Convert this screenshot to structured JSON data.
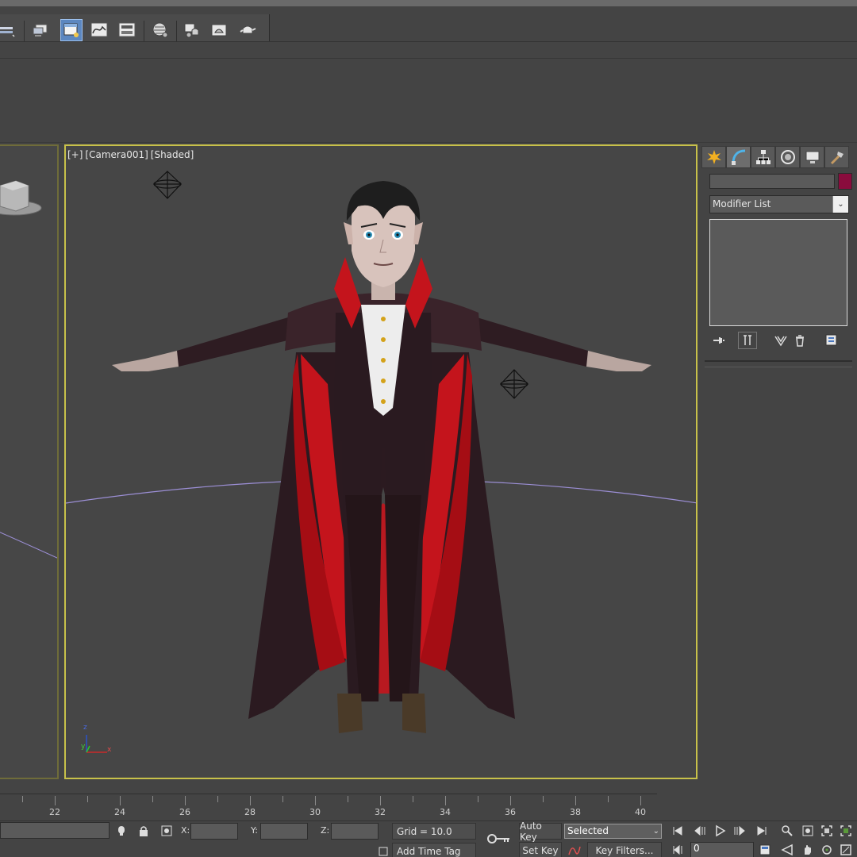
{
  "toolbar": {
    "buttons": [
      "layer-manager-icon",
      "scene-explorer-icon",
      "toggle-ribbon-icon",
      "curve-editor-icon",
      "schematic-view-icon",
      "material-editor-icon",
      "render-setup-icon",
      "rendered-frame-icon",
      "render-icon"
    ]
  },
  "left_viewport": {
    "label": ""
  },
  "main_viewport": {
    "label_plus": "[+]",
    "label_camera": "[Camera001]",
    "label_mode": "[Shaded]",
    "axis_z": "z",
    "axis_y": "y",
    "axis_x": "x"
  },
  "command_panel": {
    "tabs": [
      "create-icon",
      "modify-icon",
      "hierarchy-icon",
      "motion-icon",
      "display-icon",
      "utilities-icon"
    ],
    "object_name": "",
    "object_color": "#8a0c3d",
    "modifier_list": "Modifier List",
    "stack_tools": [
      "pin-stack-icon",
      "show-end-result-icon",
      "make-unique-icon",
      "remove-modifier-icon",
      "configure-sets-icon"
    ]
  },
  "timeline": {
    "ticks": [
      "22",
      "24",
      "26",
      "28",
      "30",
      "32",
      "34",
      "36",
      "38",
      "40"
    ]
  },
  "statusbar": {
    "x_label": "X:",
    "y_label": "Y:",
    "z_label": "Z:",
    "x_value": "",
    "y_value": "",
    "z_value": "",
    "grid": "Grid = 10.0",
    "add_time_tag": "Add Time Tag",
    "auto_key": "Auto Key",
    "set_key": "Set Key",
    "key_mode_selected": "Selected",
    "key_filters": "Key Filters...",
    "frame_value": "0"
  },
  "colors": {
    "viewport_border_active": "#c8c14a",
    "viewport_bg": "#464646",
    "ui_bg": "#444444"
  }
}
